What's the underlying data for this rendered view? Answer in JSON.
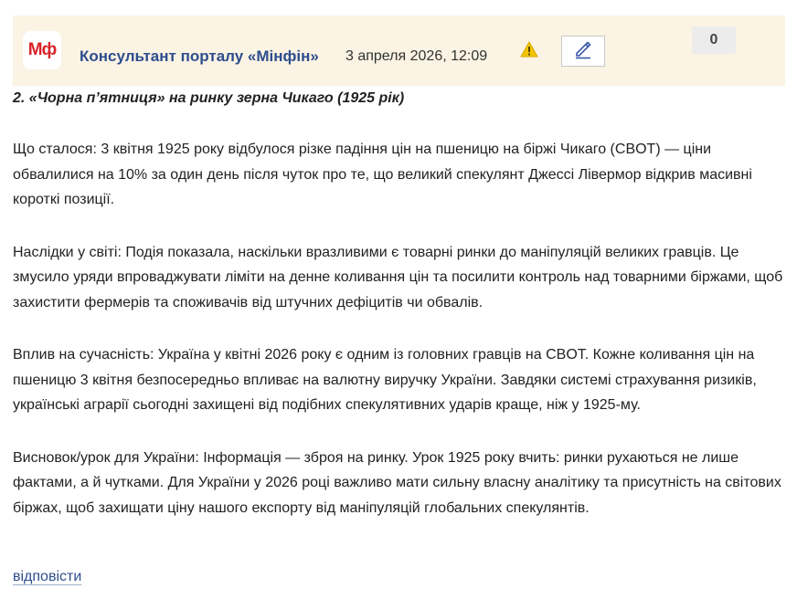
{
  "comment": {
    "logo_text": "Мф",
    "author": "Консультант порталу «Мінфін»",
    "date": "3 апреля 2026, 12:09",
    "vote_count": "0",
    "icons": [
      "warning-icon",
      "pencil-icon"
    ],
    "colors": {
      "header_bg": "#fbf3e3",
      "logo_red": "#d8232a",
      "link_blue": "#2d4d8e",
      "warning_yellow": "#f2c500"
    }
  },
  "body": {
    "heading": "2. «Чорна п’ятниця» на ринку зерна Чикаго (1925 рік)",
    "paragraphs": [
      "Що сталося: 3 квітня 1925 року відбулося різке падіння цін на пшеницю на біржі Чикаго (CBOT) — ціни обвалилися на 10% за один день після чуток про те, що великий спекулянт Джессі Лівермор відкрив масивні короткі позиції.",
      "Наслідки у світі: Подія показала, наскільки вразливими є товарні ринки до маніпуляцій великих гравців. Це змусило уряди впроваджувати ліміти на денне коливання цін та посилити контроль над товарними біржами, щоб захистити фермерів та споживачів від штучних дефіцитів чи обвалів.",
      "Вплив на сучасність: Україна у квітні 2026 року є одним із головних гравців на CBOT. Кожне коливання цін на пшеницю 3 квітня безпосередньо впливає на валютну виручку України. Завдяки системі страхування ризиків, українські аграрії сьогодні захищені від подібних спекулятивних ударів краще, ніж у 1925-му.",
      "Висновок/урок для України: Інформація — зброя на ринку. Урок 1925 року вчить: ринки рухаються не лише фактами, а й чутками. Для України у 2026 році важливо мати сильну власну аналітику та присутність на світових біржах, щоб захищати ціну нашого експорту від маніпуляцій глобальних спекулянтів."
    ]
  },
  "actions": {
    "reply_label": "відповісти"
  }
}
